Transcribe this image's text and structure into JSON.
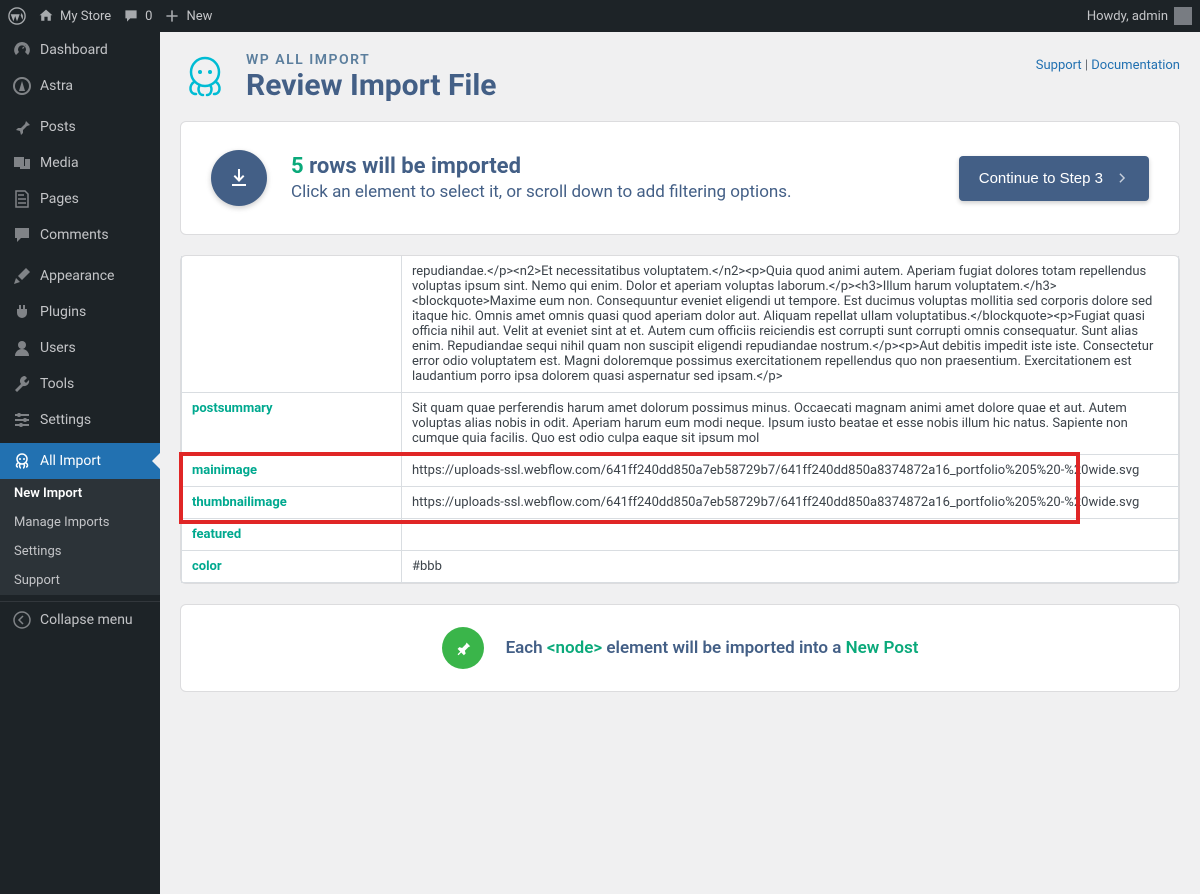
{
  "topbar": {
    "site_name": "My Store",
    "comments_count": "0",
    "new_label": "New",
    "howdy": "Howdy, admin"
  },
  "sidebar": {
    "dashboard": "Dashboard",
    "astra": "Astra",
    "posts": "Posts",
    "media": "Media",
    "pages": "Pages",
    "comments": "Comments",
    "appearance": "Appearance",
    "plugins": "Plugins",
    "users": "Users",
    "tools": "Tools",
    "settings": "Settings",
    "all_import": "All Import",
    "sub": {
      "new_import": "New Import",
      "manage_imports": "Manage Imports",
      "settings": "Settings",
      "support": "Support"
    },
    "collapse": "Collapse menu"
  },
  "header": {
    "brand": "WP ALL IMPORT",
    "title": "Review Import File",
    "support": "Support",
    "docs": "Documentation",
    "sep": " | "
  },
  "summary": {
    "count": "5",
    "rows_text": " rows will be imported",
    "sub": "Click an element to select it, or scroll down to add filtering options.",
    "continue": "Continue to Step 3"
  },
  "table": {
    "partial_value": "repudiandae.</p><n2>Et necessitatibus voluptatem.</n2><p>Quia quod animi autem. Aperiam fugiat dolores totam repellendus voluptas ipsum sint. Nemo qui enim. Dolor et aperiam voluptas laborum.</p><h3>Illum harum voluptatem.</h3><blockquote>Maxime eum non. Consequuntur eveniet eligendi ut tempore. Est ducimus voluptas mollitia sed corporis dolore sed itaque hic. Omnis amet omnis quasi quod aperiam dolor aut. Aliquam repellat ullam voluptatibus.</blockquote><p>Fugiat quasi officia nihil aut. Velit at eveniet sint at et. Autem cum officiis reiciendis est corrupti sunt corrupti omnis consequatur. Sunt alias enim. Repudiandae sequi nihil quam non suscipit eligendi repudiandae nostrum.</p><p>Aut debitis impedit iste iste. Consectetur error odio voluptatem est. Magni doloremque possimus exercitationem repellendus quo non praesentium. Exercitationem est laudantium porro ipsa dolorem quasi aspernatur sed ipsam.</p>",
    "rows": [
      {
        "key": "postsummary",
        "value": "Sit quam quae perferendis harum amet dolorum possimus minus. Occaecati magnam animi amet dolore quae et aut. Autem voluptas alias nobis in odit. Aperiam harum eum modi neque. Ipsum iusto beatae et esse nobis illum hic natus. Sapiente non cumque quia facilis. Quo est odio culpa eaque sit ipsum mol"
      },
      {
        "key": "mainimage",
        "value": "https://uploads-ssl.webflow.com/641ff240dd850a7eb58729b7/641ff240dd850a8374872a16_portfolio%205%20-%20wide.svg"
      },
      {
        "key": "thumbnailimage",
        "value": "https://uploads-ssl.webflow.com/641ff240dd850a7eb58729b7/641ff240dd850a8374872a16_portfolio%205%20-%20wide.svg"
      },
      {
        "key": "featured",
        "value": ""
      },
      {
        "key": "color",
        "value": "#bbb"
      }
    ]
  },
  "footer": {
    "each": "Each ",
    "node": "<node>",
    "mid": " element will be imported into a ",
    "newpost": "New Post"
  }
}
